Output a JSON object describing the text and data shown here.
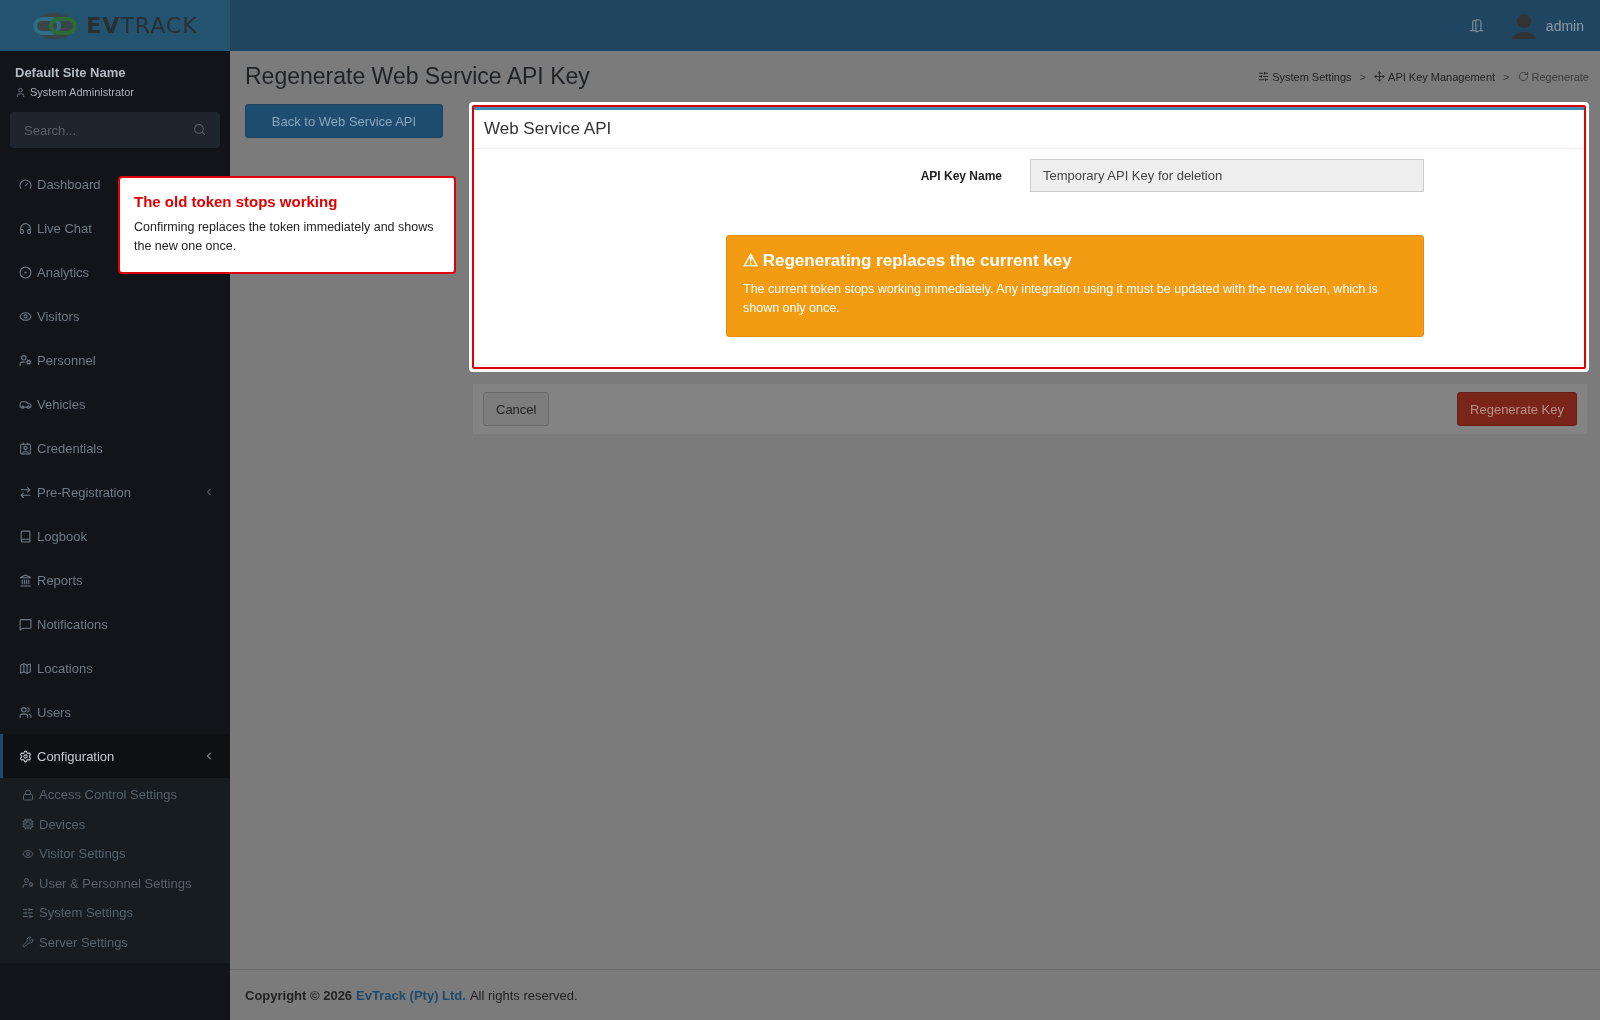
{
  "logo": {
    "text": "**EV**TRACK"
  },
  "topbar": {
    "user": "admin"
  },
  "sidebar": {
    "site_name": "Default Site Name",
    "role": "System Administrator",
    "search": {
      "placeholder": "Search..."
    },
    "items": [
      {
        "label": "Dashboard",
        "kind": "link",
        "selected": false
      },
      {
        "label": "Live Chat",
        "kind": "link",
        "selected": false
      },
      {
        "label": "Analytics",
        "kind": "link",
        "selected": false
      },
      {
        "label": "Visitors",
        "kind": "link",
        "selected": false
      },
      {
        "label": "Personnel",
        "kind": "link",
        "selected": false
      },
      {
        "label": "Vehicles",
        "kind": "link",
        "selected": false
      },
      {
        "label": "Credentials",
        "kind": "link",
        "selected": false
      },
      {
        "label": "Pre-Registration",
        "kind": "group",
        "selected": false
      },
      {
        "label": "Logbook",
        "kind": "link",
        "selected": false
      },
      {
        "label": "Reports",
        "kind": "link",
        "selected": false
      },
      {
        "label": "Notifications",
        "kind": "link",
        "selected": false
      },
      {
        "label": "Locations",
        "kind": "link",
        "selected": false
      },
      {
        "label": "Users",
        "kind": "link",
        "selected": false
      },
      {
        "label": "Configuration",
        "kind": "group",
        "selected": true,
        "children": [
          {
            "label": "Access Control Settings"
          },
          {
            "label": "Devices"
          },
          {
            "label": "Visitor Settings"
          },
          {
            "label": "User & Personnel Settings"
          },
          {
            "label": "System Settings"
          },
          {
            "label": "Server Settings"
          }
        ]
      }
    ]
  },
  "page": {
    "title": "Regenerate Web Service API Key",
    "breadcrumb": [
      {
        "label": "System Settings",
        "current": false
      },
      {
        "label": "API Key Management",
        "current": false
      },
      {
        "label": "Regenerate",
        "current": true
      }
    ],
    "separator": ">",
    "back_button": "Back to Web Service API",
    "card": {
      "title": "Web Service API",
      "field": {
        "label": "API Key Name",
        "value": "Temporary API Key for deletion"
      },
      "warning": {
        "icon": "⚠",
        "title": "Regenerating replaces the current key",
        "text": "The current token stops working immediately. Any integration using it must be updated with the new token, which is shown only once."
      }
    },
    "actions": {
      "cancel": "Cancel",
      "confirm": "Regenerate Key"
    }
  },
  "tour_tooltip": {
    "title": "The old token stops working",
    "text": "Confirming replaces the token immediately and shows the new one once."
  },
  "footer": {
    "prefix": "Copyright © 2026",
    "company": "EvTrack (Pty) Ltd.",
    "suffix": "All rights reserved."
  }
}
